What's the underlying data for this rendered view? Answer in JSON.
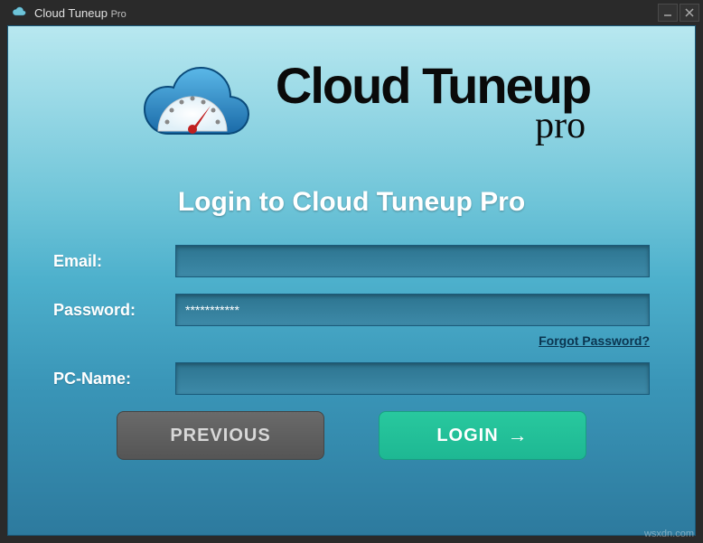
{
  "window": {
    "title_main": "Cloud Tuneup",
    "title_sub": "Pro"
  },
  "logo": {
    "main": "Cloud Tuneup",
    "sub": "pro"
  },
  "heading": "Login to Cloud Tuneup Pro",
  "form": {
    "email_label": "Email:",
    "email_value": "",
    "password_label": "Password:",
    "password_value": "***********",
    "pcname_label": "PC-Name:",
    "pcname_value": "",
    "forgot_password": "Forgot Password?"
  },
  "buttons": {
    "previous": "PREVIOUS",
    "login": "LOGIN"
  },
  "watermark": "wsxdn.com"
}
